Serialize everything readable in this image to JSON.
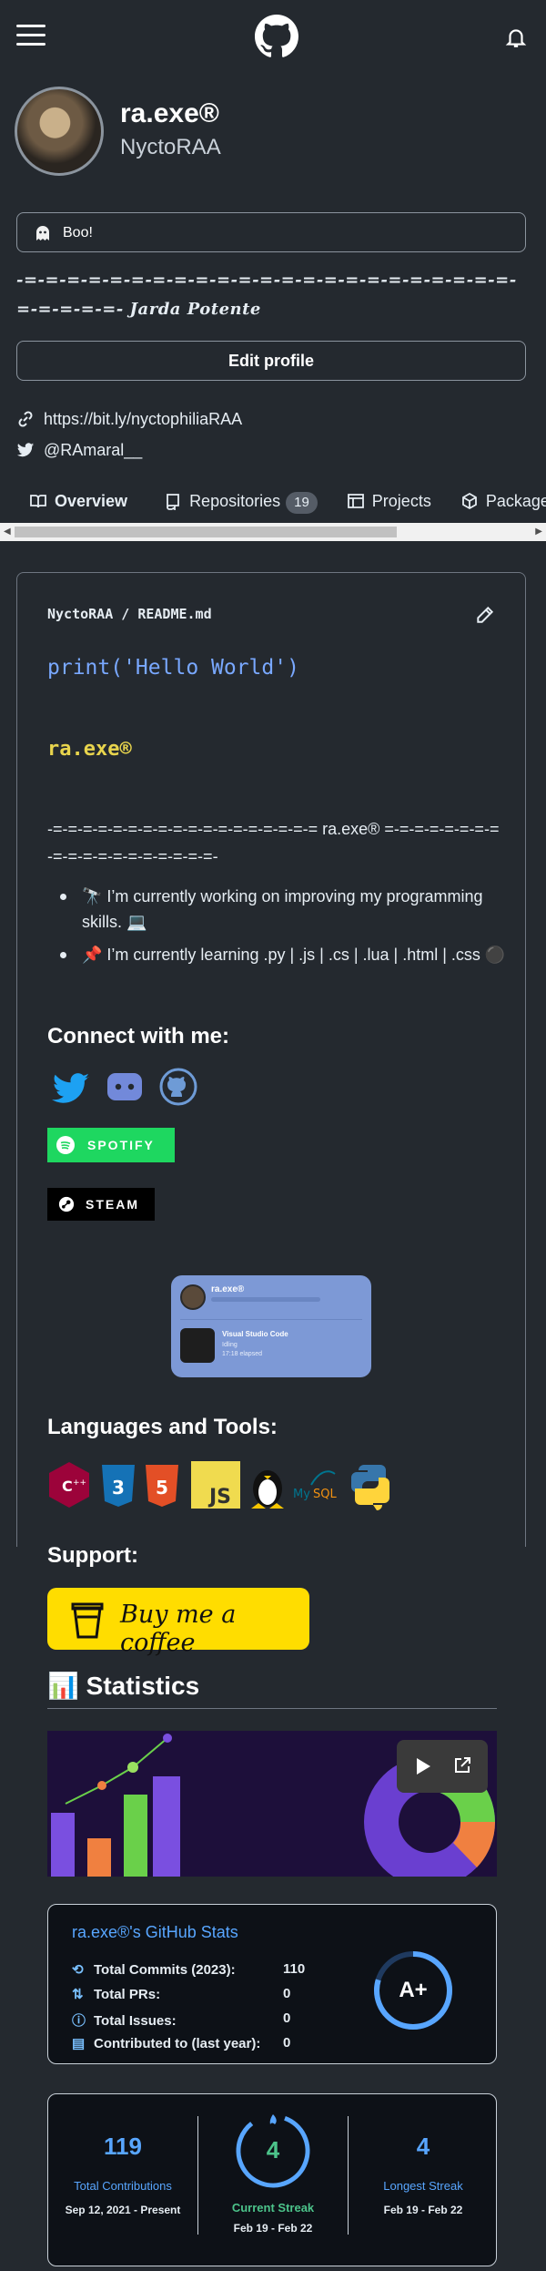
{
  "header": {
    "menu_icon": "hamburger-icon",
    "logo_icon": "github-logo-icon",
    "notifications_icon": "bell-icon"
  },
  "profile": {
    "name": "ra.exe®",
    "login": "NyctoRAA",
    "status": "Boo!",
    "bio": "-=-=-=-=-=-=-=-=-=-=-=-=-=-=-=-=-=-=-=-=-=-=-=-=-=-=-=-=- Jarda Potente",
    "edit_button": "Edit profile",
    "website": "https://bit.ly/nyctophiliaRAA",
    "twitter": "@RAmaral__"
  },
  "tabs": [
    {
      "label": "Overview",
      "icon": "book-icon"
    },
    {
      "label": "Repositories",
      "icon": "repo-icon",
      "count": "19"
    },
    {
      "label": "Projects",
      "icon": "table-icon"
    },
    {
      "label": "Packages",
      "icon": "package-icon"
    }
  ],
  "readme": {
    "path_owner": "NyctoRAA",
    "path_sep": " / ",
    "path_file": "README.md",
    "code_hello": "print('Hello World')",
    "code_name": "ra.exe®",
    "divider": "-=-=-=-=-=-=-=-=-=-=-=-=-=-=-=-=-=-= ra.exe® =-=-=-=-=-=-=-=-=-=-=-=-=-=-=-=-=-=-=-",
    "bullets": [
      "🔭 I’m currently working on improving my programming skills. 💻",
      "📌 I’m currently learning .py | .js | .cs | .lua | .html | .css ⚫"
    ],
    "connect_heading": "Connect with me:",
    "spotify_badge": "SPOTIFY",
    "steam_badge": "STEAM",
    "discord_card": {
      "name": "ra.exe®",
      "activity": "Visual Studio Code",
      "detail": "Idling",
      "elapsed": "17:18 elapsed"
    },
    "languages_heading": "Languages and Tools:",
    "languages": [
      "C++",
      "CSS3",
      "HTML5",
      "JS",
      "Linux",
      "MySQL",
      "Python"
    ],
    "support_heading": "Support:",
    "bmc_label": "Buy me a coffee",
    "stats_heading": "📊 Statistics"
  },
  "github_stats": {
    "title": "ra.exe®'s GitHub Stats",
    "rows": [
      {
        "icon": "history-icon",
        "label": "Total Commits (2023):",
        "value": "110"
      },
      {
        "icon": "pull-request-icon",
        "label": "Total PRs:",
        "value": "0"
      },
      {
        "icon": "issue-icon",
        "label": "Total Issues:",
        "value": "0"
      },
      {
        "icon": "repo-icon",
        "label": "Contributed to (last year):",
        "value": "0"
      }
    ],
    "grade": "A+"
  },
  "streak": {
    "total": "119",
    "total_label": "Total Contributions",
    "total_range": "Sep 12, 2021 - Present",
    "current": "4",
    "current_label": "Current Streak",
    "current_range": "Feb 19 - Feb 22",
    "longest": "4",
    "longest_label": "Longest Streak",
    "longest_range": "Feb 19 - Feb 22"
  },
  "colors": {
    "background": "#24292f",
    "link_blue": "#58a6ff",
    "spotify": "#1ed760",
    "bmc": "#ffdd00",
    "streak_orange": "#fb8c00"
  }
}
